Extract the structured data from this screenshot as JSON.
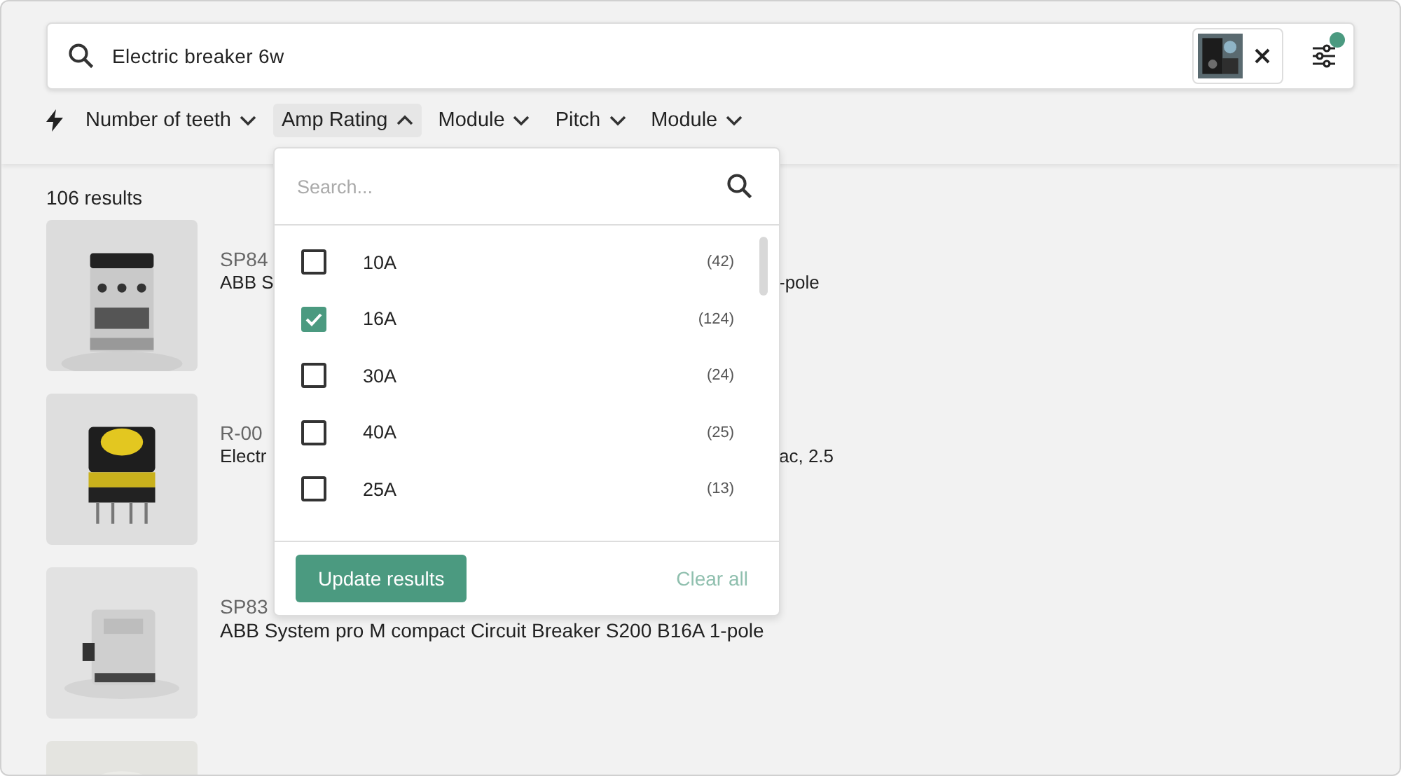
{
  "search": {
    "value": "Electric breaker 6w",
    "filters_active": true
  },
  "filters": [
    {
      "label": "Number of teeth",
      "expanded": false
    },
    {
      "label": "Amp Rating",
      "expanded": true
    },
    {
      "label": "Module",
      "expanded": false
    },
    {
      "label": "Pitch",
      "expanded": false
    },
    {
      "label": "Module",
      "expanded": false
    }
  ],
  "results_count": "106 results",
  "results": [
    {
      "code": "SP84",
      "title_parts": [
        "ABB S",
        "-pole"
      ],
      "kind": "picture"
    },
    {
      "code": "R-00",
      "title_parts": [
        "Electr",
        "ac, 2.5"
      ],
      "kind": "picture"
    },
    {
      "code": "SP83",
      "title_parts": [
        "ABB System pro M compact Circuit Breaker S200 B16A 1-pole"
      ],
      "kind": "picture"
    },
    {
      "kind": "picture"
    }
  ],
  "dropdown": {
    "placeholder": "Search...",
    "options": [
      {
        "label": "10A",
        "count": "(42)",
        "checked": false
      },
      {
        "label": "16A",
        "count": "(124)",
        "checked": true
      },
      {
        "label": "30A",
        "count": "(24)",
        "checked": false
      },
      {
        "label": "40A",
        "count": "(25)",
        "checked": false
      },
      {
        "label": "25A",
        "count": "(13)",
        "checked": false
      }
    ],
    "apply": "Update results",
    "clear": {
      "label": "Clear all",
      "disabled": true
    }
  }
}
